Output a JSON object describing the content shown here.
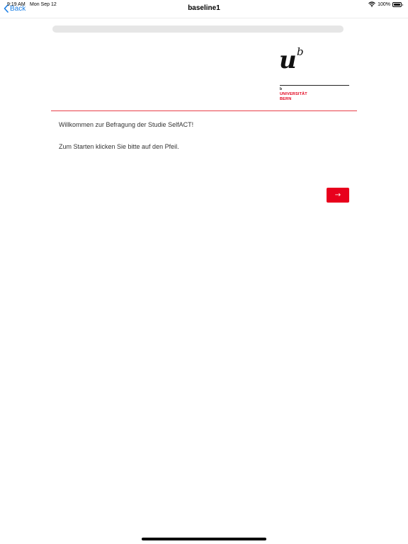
{
  "status_bar": {
    "time": "9:19 AM",
    "date": "Mon Sep 12",
    "battery": "100%",
    "icons": {
      "wifi": "wifi-icon",
      "battery": "battery-icon"
    }
  },
  "nav": {
    "back_label": "Back",
    "title": "baseline1",
    "back_icon": "chevron-left-icon",
    "accent_color": "#1a7fe6"
  },
  "progress": {
    "fraction": 0.0
  },
  "logo": {
    "glyph_u": "u",
    "glyph_b": "b",
    "small_b": "b",
    "line1": "UNIVERSITÄT",
    "line2": "BERN",
    "brand_color": "#e2001a"
  },
  "content": {
    "welcome": "Willkommen zur Befragung der Studie SelfACT!",
    "instruction": "Zum Starten klicken Sie bitte auf den Pfeil."
  },
  "next_button": {
    "label": "→",
    "color": "#e8001c"
  }
}
